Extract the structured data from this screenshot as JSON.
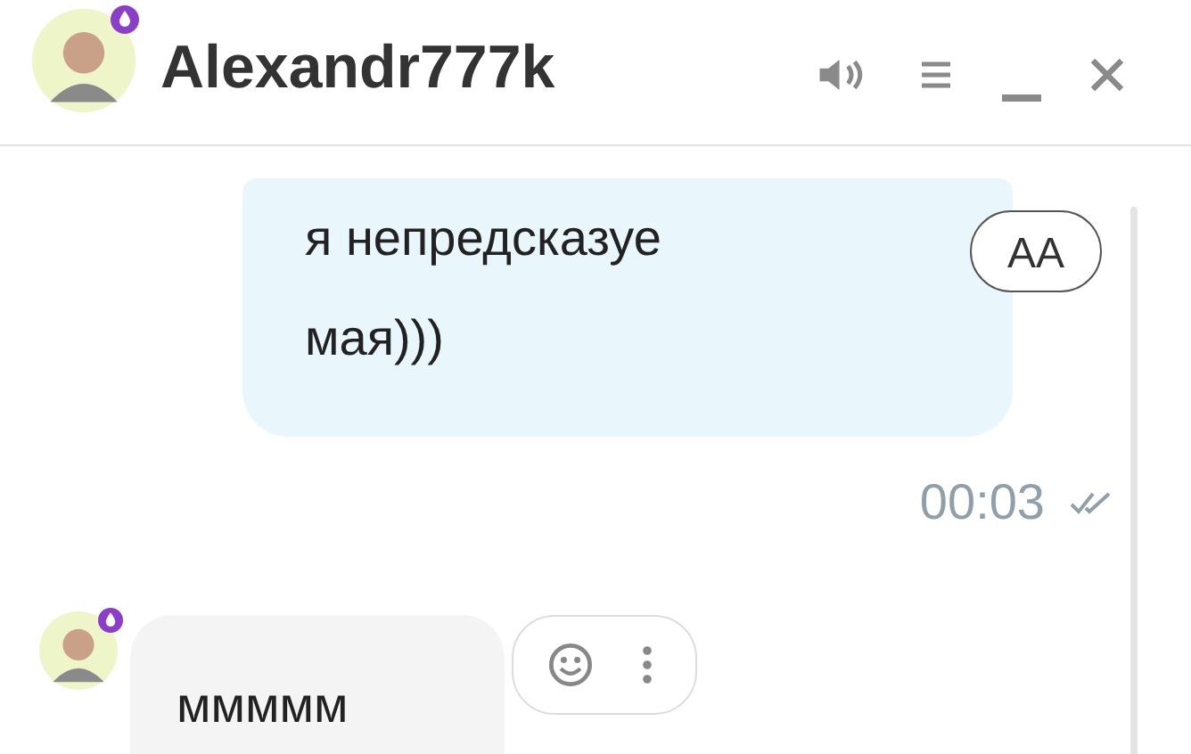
{
  "header": {
    "name": "Alexandr777k",
    "online_badge": true
  },
  "messages": [
    {
      "kind": "outgoing",
      "lines": [
        "я непредсказуе",
        "мая)))"
      ],
      "font_button": "AA",
      "time": "00:03",
      "read": true
    },
    {
      "kind": "incoming",
      "text": "ммммм",
      "badge": true
    }
  ]
}
